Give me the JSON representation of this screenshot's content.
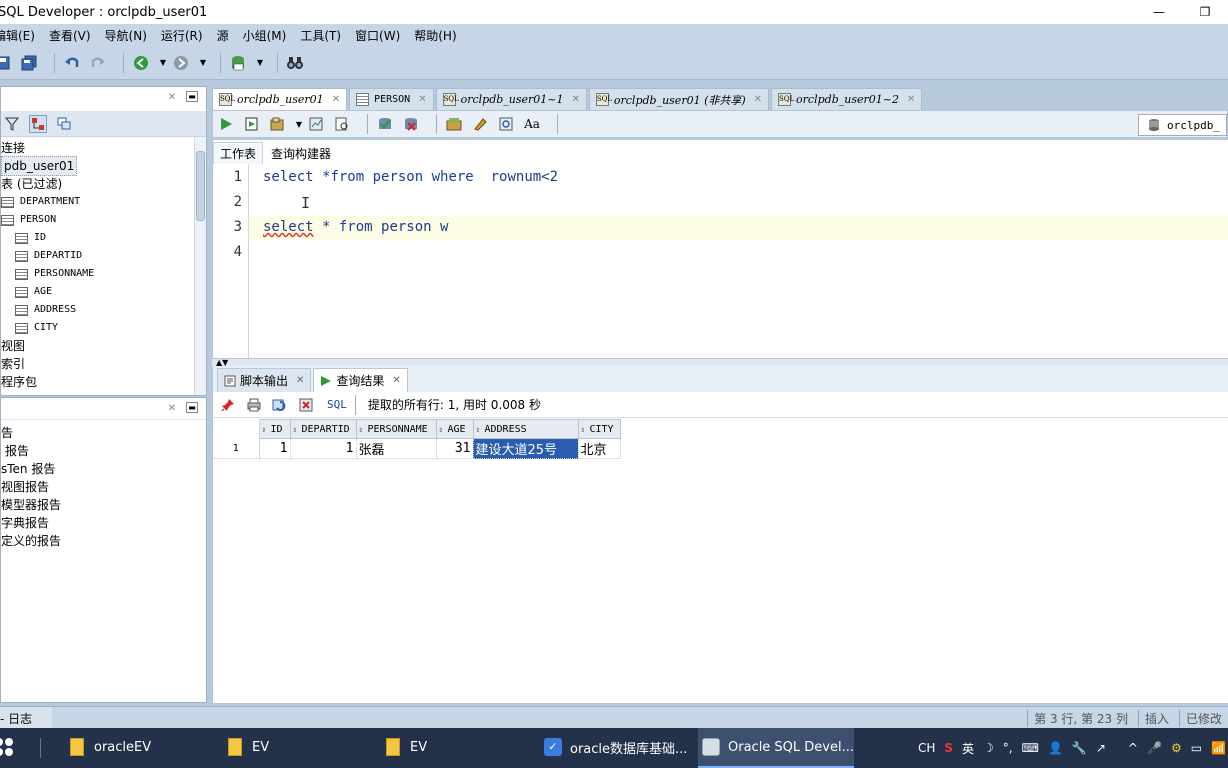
{
  "window": {
    "title": "SQL Developer : orclpdb_user01",
    "min_glyph": "—",
    "restore_glyph": "❐"
  },
  "menu": [
    "编辑(E)",
    "查看(V)",
    "导航(N)",
    "运行(R)",
    "源",
    "小组(M)",
    "工具(T)",
    "窗口(W)",
    "帮助(H)"
  ],
  "connections": {
    "tree": [
      {
        "label": "连接",
        "indent": 0,
        "icon": "none"
      },
      {
        "label": "pdb_user01",
        "indent": 0,
        "icon": "none",
        "selected": true
      },
      {
        "label": "表 (已过滤)",
        "indent": 0,
        "icon": "none"
      },
      {
        "label": "DEPARTMENT",
        "indent": 0,
        "icon": "table",
        "mono": true
      },
      {
        "label": "PERSON",
        "indent": 0,
        "icon": "table",
        "mono": true
      },
      {
        "label": "ID",
        "indent": 1,
        "icon": "column",
        "mono": true
      },
      {
        "label": "DEPARTID",
        "indent": 1,
        "icon": "column",
        "mono": true
      },
      {
        "label": "PERSONNAME",
        "indent": 1,
        "icon": "column",
        "mono": true
      },
      {
        "label": "AGE",
        "indent": 1,
        "icon": "column",
        "mono": true
      },
      {
        "label": "ADDRESS",
        "indent": 1,
        "icon": "column",
        "mono": true
      },
      {
        "label": "CITY",
        "indent": 1,
        "icon": "column",
        "mono": true
      },
      {
        "label": "视图",
        "indent": 0,
        "icon": "none"
      },
      {
        "label": "索引",
        "indent": 0,
        "icon": "none"
      },
      {
        "label": "程序包",
        "indent": 0,
        "icon": "none"
      }
    ]
  },
  "reports": {
    "items": [
      "告",
      "报告",
      "sTen 报告",
      "视图报告",
      "模型器报告",
      "字典报告",
      "定义的报告"
    ]
  },
  "editor_tabs": [
    {
      "label": "orclpdb_user01",
      "active": true,
      "icon": "sql"
    },
    {
      "label": "PERSON",
      "active": false,
      "icon": "table"
    },
    {
      "label": "orclpdb_user01~1",
      "active": false,
      "icon": "sql"
    },
    {
      "label": "orclpdb_user01 (非共享)",
      "active": false,
      "icon": "sql"
    },
    {
      "label": "orclpdb_user01~2",
      "active": false,
      "icon": "sql"
    }
  ],
  "connection_selector": "orclpdb_",
  "sub_tabs": [
    "工作表",
    "查询构建器"
  ],
  "editor": {
    "line_numbers": [
      "1",
      "2",
      "3",
      "4"
    ],
    "lines": [
      {
        "text_a": "select *",
        "text_b": "from person ",
        "text_c": "where",
        "text_d": "  rownum<2"
      },
      {
        "text_a": "",
        "text_b": "",
        "text_c": "",
        "text_d": ""
      },
      {
        "text_a": "select",
        "text_b": " * ",
        "text_c": "from",
        "text_d": " person w"
      },
      {
        "text_a": "",
        "text_b": "",
        "text_c": "",
        "text_d": ""
      }
    ],
    "current_line": 3
  },
  "result_tabs": [
    {
      "label": "脚本输出",
      "active": false
    },
    {
      "label": "查询结果",
      "active": true
    }
  ],
  "results_toolbar": {
    "sql_label": "SQL",
    "status": "提取的所有行: 1, 用时 0.008 秒"
  },
  "grid": {
    "columns": [
      "ID",
      "DEPARTID",
      "PERSONNAME",
      "AGE",
      "ADDRESS",
      "CITY"
    ],
    "rows": [
      {
        "rownum": "1",
        "cells": [
          "1",
          "1",
          "张磊",
          "31",
          "建设大道25号",
          "北京"
        ]
      }
    ]
  },
  "status_bar": {
    "left": "- 日志",
    "position": "第 3 行, 第 23 列",
    "mode": "插入",
    "modified": "已修改"
  },
  "taskbar": {
    "tasks": [
      {
        "label": "oracleEV",
        "icon": "folder",
        "active": false
      },
      {
        "label": "EV",
        "icon": "folder",
        "active": false
      },
      {
        "label": "EV",
        "icon": "folder",
        "active": false
      },
      {
        "label": "oracle数据库基础...",
        "icon": "app",
        "active": false
      },
      {
        "label": "Oracle SQL Devel...",
        "icon": "sqldev",
        "active": true
      }
    ],
    "tray": [
      "CH",
      "S",
      "英",
      "☽",
      "°,",
      "⌨",
      "👤",
      "🔧",
      "↗",
      "^",
      "🎤",
      "⚙",
      "▭",
      "📶"
    ]
  },
  "colors": {
    "accent": "#2a5db0",
    "chrome": "#c7d6e6",
    "taskbar": "#23324a"
  }
}
